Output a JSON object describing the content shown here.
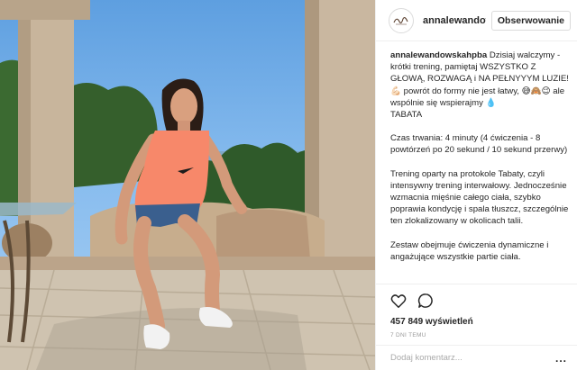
{
  "header": {
    "username": "annalewandow",
    "follow_label": "Obserwowanie"
  },
  "caption": {
    "username": "annalewandowskahpba",
    "p1_line1": "Dzisiaj walczymy - krótki trening, pamiętaj WSZYSTKO Z GŁOWĄ, ROZWAGĄ i NA PEŁNYYYM LUZIE!",
    "p1_emoji1": "💪🏻",
    "p1_line2": "powrót do formy nie jest łatwy,",
    "p1_emoji2": "😅🙈😉",
    "p1_line3": "ale wspólnie się wspierajmy",
    "p1_emoji3": "💧",
    "p1_line4": "TABATA",
    "p2": "Czas trwania: 4 minuty (4 ćwiczenia - 8 powtórzeń po 20 sekund / 10 sekund przerwy)",
    "p3": "Trening oparty na protokole Tabaty, czyli intensywny trening interwałowy. Jednocześnie wzmacnia mięśnie całego ciała, szybko poprawia kondycję i spala tłuszcz, szczególnie ten zlokalizowany w okolicach talii.",
    "p4": "Zestaw obejmuje ćwiczenia dynamiczne i angażujące wszystkie partie ciała."
  },
  "actions": {
    "views": "457 849 wyświetleń",
    "time": "7 DNI TEMU"
  },
  "comment": {
    "placeholder": "Dodaj komentarz...",
    "more_label": "..."
  },
  "colors": {
    "shirt": "#f7886a",
    "shorts": "#3a5f8e",
    "sky": "#6eaae6",
    "stone": "#c9b8a2"
  },
  "icons": [
    "heart-icon",
    "comment-icon",
    "more-options-icon"
  ]
}
